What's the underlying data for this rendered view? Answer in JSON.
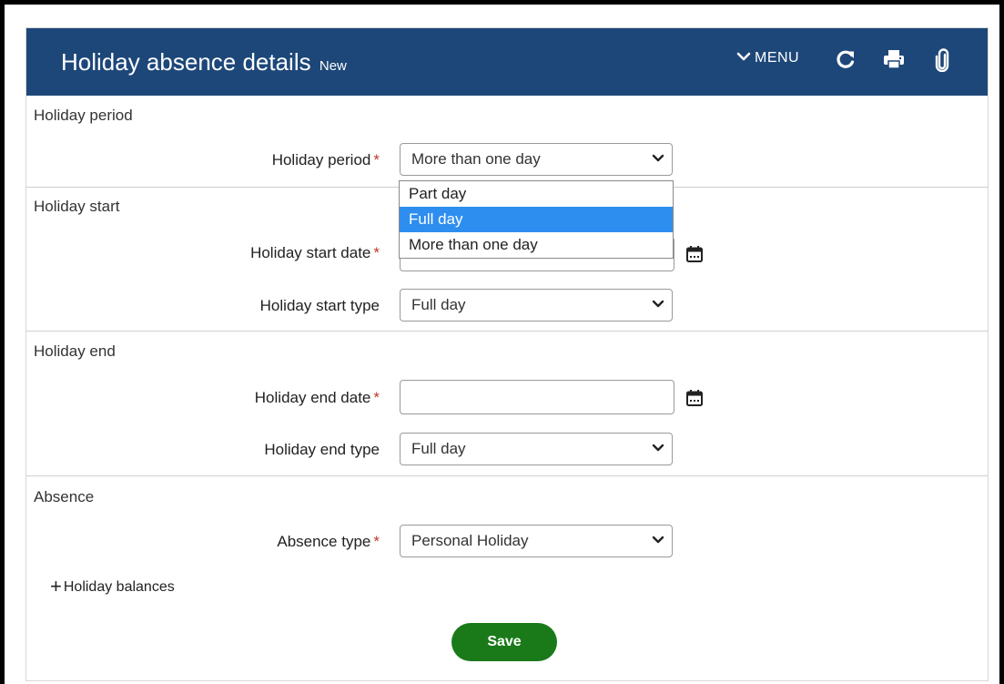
{
  "header": {
    "title": "Holiday absence details",
    "status": "New",
    "menu_label": "MENU",
    "icons": [
      "chevron-down-icon",
      "refresh-icon",
      "print-icon",
      "attachment-icon"
    ],
    "background_color": "#1d4779"
  },
  "sections": {
    "period": {
      "title": "Holiday period",
      "field_label": "Holiday period",
      "required_mark": "*",
      "value": "More than one day",
      "options": [
        "Part day",
        "Full day",
        "More than one day"
      ],
      "highlighted_option": "Full day"
    },
    "start": {
      "title": "Holiday start",
      "date_label": "Holiday start date",
      "date_required_mark": "*",
      "date_value": "",
      "type_label": "Holiday start type",
      "type_value": "Full day"
    },
    "end": {
      "title": "Holiday end",
      "date_label": "Holiday end date",
      "date_required_mark": "*",
      "date_value": "",
      "type_label": "Holiday end type",
      "type_value": "Full day"
    },
    "absence": {
      "title": "Absence",
      "type_label": "Absence type",
      "required_mark": "*",
      "type_value": "Personal Holiday"
    }
  },
  "balances_label": "Holiday balances",
  "save_label": "Save",
  "colors": {
    "save_button": "#1a7a1a",
    "highlight": "#2e8ef0",
    "required": "#c0392b"
  }
}
